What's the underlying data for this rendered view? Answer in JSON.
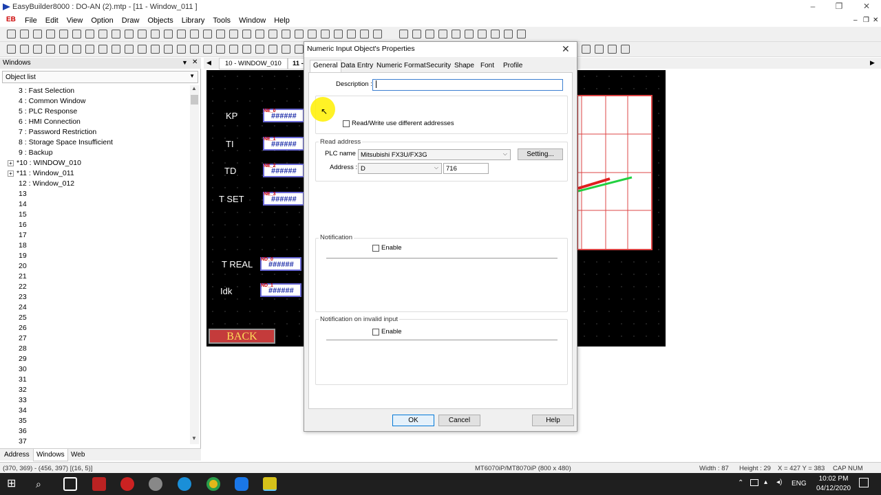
{
  "window": {
    "title": "EasyBuilder8000 : DO-AN (2).mtp - [11 - Window_011 ]",
    "min": "–",
    "max": "❐",
    "close": "✕"
  },
  "menu": {
    "logo": "EB",
    "items": [
      "File",
      "Edit",
      "View",
      "Option",
      "Draw",
      "Objects",
      "Library",
      "Tools",
      "Window",
      "Help"
    ],
    "mdi_controls": [
      "–",
      "❐",
      "✕"
    ]
  },
  "left_pane": {
    "header": "Windows",
    "pin": "▼",
    "close": "✕",
    "combo": "Object list",
    "tree": [
      {
        "label": "3 : Fast Selection",
        "exp": false
      },
      {
        "label": "4 : Common Window",
        "exp": false
      },
      {
        "label": "5 : PLC Response",
        "exp": false
      },
      {
        "label": "6 : HMI Connection",
        "exp": false
      },
      {
        "label": "7 : Password Restriction",
        "exp": false
      },
      {
        "label": "8 : Storage Space Insufficient",
        "exp": false
      },
      {
        "label": "9 : Backup",
        "exp": false
      },
      {
        "label": "*10 : WINDOW_010",
        "exp": true
      },
      {
        "label": "*11 : Window_011",
        "exp": true
      },
      {
        "label": "12 : Window_012",
        "exp": false
      },
      {
        "label": "13",
        "exp": false
      },
      {
        "label": "14",
        "exp": false
      },
      {
        "label": "15",
        "exp": false
      },
      {
        "label": "16",
        "exp": false
      },
      {
        "label": "17",
        "exp": false
      },
      {
        "label": "18",
        "exp": false
      },
      {
        "label": "19",
        "exp": false
      },
      {
        "label": "20",
        "exp": false
      },
      {
        "label": "21",
        "exp": false
      },
      {
        "label": "22",
        "exp": false
      },
      {
        "label": "23",
        "exp": false
      },
      {
        "label": "24",
        "exp": false
      },
      {
        "label": "25",
        "exp": false
      },
      {
        "label": "26",
        "exp": false
      },
      {
        "label": "27",
        "exp": false
      },
      {
        "label": "28",
        "exp": false
      },
      {
        "label": "29",
        "exp": false
      },
      {
        "label": "30",
        "exp": false
      },
      {
        "label": "31",
        "exp": false
      },
      {
        "label": "32",
        "exp": false
      },
      {
        "label": "33",
        "exp": false
      },
      {
        "label": "34",
        "exp": false
      },
      {
        "label": "35",
        "exp": false
      },
      {
        "label": "36",
        "exp": false
      },
      {
        "label": "37",
        "exp": false
      }
    ],
    "tabs": [
      "Address",
      "Windows",
      "Web"
    ]
  },
  "doc_tabs": {
    "tab1": "10 - WINDOW_010",
    "tab2": "11 - W"
  },
  "canvas": {
    "labels": [
      "KP",
      "TI",
      "TD",
      "T SET",
      "T REAL",
      "Idk"
    ],
    "num_text": "######",
    "ne_tags": [
      "NE_0",
      "NE_1",
      "NE_2",
      "NE_3"
    ],
    "nd_tags": [
      "ND_0",
      "ND_1"
    ],
    "back": "BACK"
  },
  "dialog": {
    "title": "Numeric Input Object's Properties",
    "close": "✕",
    "tabs": [
      "General",
      "Data Entry",
      "Numeric Format",
      "Security",
      "Shape",
      "Font",
      "Profile"
    ],
    "description_label": "Description :",
    "description_value": "",
    "rw_diff": "Read/Write use different addresses",
    "read_address": "Read address",
    "plc_name_label": "PLC name :",
    "plc_name_value": "Mitsubishi FX3U/FX3G",
    "setting": "Setting...",
    "address_label": "Address :",
    "address_device": "D",
    "address_value": "716",
    "notification": "Notification",
    "enable": "Enable",
    "notification_invalid": "Notification on invalid input",
    "ok": "OK",
    "cancel": "Cancel",
    "help": "Help"
  },
  "status": {
    "coords": "(370, 369) - (456, 397) [(16, 5)]",
    "model": "MT6070iP/MT8070iP (800 x 480)",
    "width": "Width : 87",
    "height": "Height : 29",
    "xy": "X = 427   Y = 383",
    "caps": "CAP  NUM  SCRL"
  },
  "taskbar": {
    "lang": "ENG",
    "time": "10:02 PM",
    "date": "04/12/2020"
  },
  "colors": {
    "canvas_bg": "#000000",
    "accent": "#0078d7",
    "back_btn": "#c43b3b",
    "graph_grid": "#dd4444"
  }
}
